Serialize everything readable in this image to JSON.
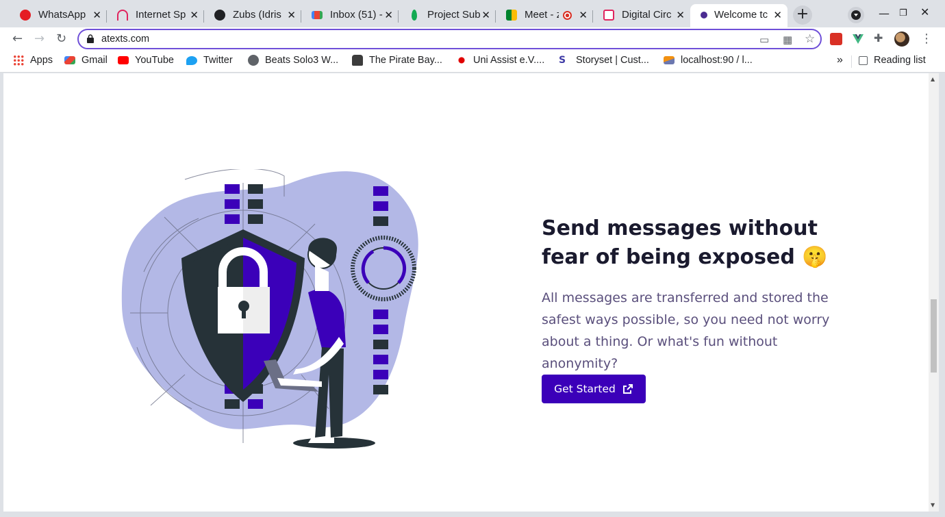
{
  "browser": {
    "tabs": [
      {
        "title": "WhatsApp",
        "icon": "whatsapp-icon",
        "color": "#e51c23"
      },
      {
        "title": "Internet Sp",
        "icon": "speedtest-icon",
        "color": "#e0245e"
      },
      {
        "title": "Zubs (Idris",
        "icon": "github-icon",
        "color": "#202124"
      },
      {
        "title": "Inbox (51) -",
        "icon": "gmail-icon",
        "color": "#ea4335"
      },
      {
        "title": "Project Sub",
        "icon": "mongodb-icon",
        "color": "#13aa52"
      },
      {
        "title": "Meet - z",
        "icon": "meet-icon",
        "color": "#00832d"
      },
      {
        "title": "Digital Circ",
        "icon": "digital-circle-icon",
        "color": "#e0245e"
      },
      {
        "title": "Welcome tc",
        "icon": "atexts-icon",
        "color": "#4b2c91"
      }
    ],
    "active_tab": 7,
    "new_tab_label": "+",
    "url": "atexts.com",
    "bookmarks": [
      {
        "label": "Apps",
        "icon": "apps-grid-icon"
      },
      {
        "label": "Gmail",
        "icon": "gmail-icon"
      },
      {
        "label": "YouTube",
        "icon": "youtube-icon"
      },
      {
        "label": "Twitter",
        "icon": "twitter-icon"
      },
      {
        "label": "Beats Solo3 W...",
        "icon": "apple-icon"
      },
      {
        "label": "The Pirate Bay...",
        "icon": "pirate-bay-icon"
      },
      {
        "label": "Uni Assist e.V....",
        "icon": "uni-assist-icon"
      },
      {
        "label": "Storyset | Cust...",
        "icon": "storyset-icon"
      },
      {
        "label": "localhost:90 / l...",
        "icon": "phpmyadmin-icon"
      }
    ],
    "bookmarks_overflow": "»",
    "reading_list": "Reading list"
  },
  "hero": {
    "headline": "Send messages without fear of being exposed 🤫",
    "description": "All messages are transferred and stored the safest ways possible, so you need not worry about a thing. Or what's fun without anonymity?",
    "cta_label": "Get Started",
    "cta_icon": "external-link-icon",
    "accent_color": "#3b00b9"
  }
}
